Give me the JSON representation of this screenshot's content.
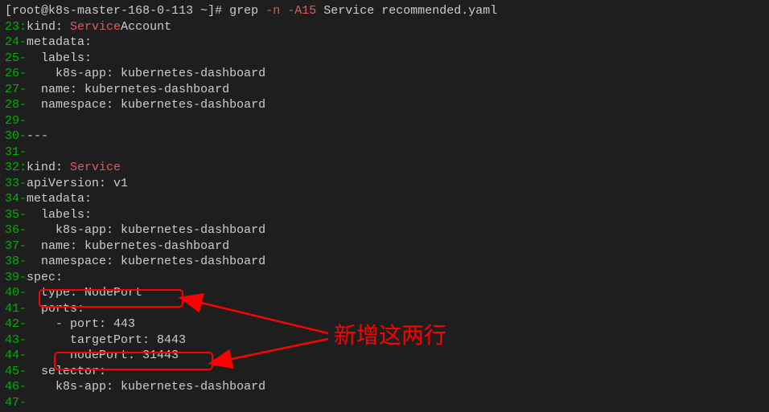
{
  "prompt": {
    "user": "root",
    "host": "k8s-master-168-0-113",
    "path": "~",
    "symbol": "#"
  },
  "command": {
    "base": "grep",
    "flags": "-n -A15",
    "pattern": "Service",
    "file": "recommended.yaml"
  },
  "lines": [
    {
      "no": "23",
      "sep": ":",
      "pre": "kind: ",
      "match": "Service",
      "post": "Account"
    },
    {
      "no": "24",
      "sep": "-",
      "pre": "metadata:",
      "match": "",
      "post": ""
    },
    {
      "no": "25",
      "sep": "-",
      "pre": "  labels:",
      "match": "",
      "post": ""
    },
    {
      "no": "26",
      "sep": "-",
      "pre": "    k8s-app: kubernetes-dashboard",
      "match": "",
      "post": ""
    },
    {
      "no": "27",
      "sep": "-",
      "pre": "  name: kubernetes-dashboard",
      "match": "",
      "post": ""
    },
    {
      "no": "28",
      "sep": "-",
      "pre": "  namespace: kubernetes-dashboard",
      "match": "",
      "post": ""
    },
    {
      "no": "29",
      "sep": "-",
      "pre": "",
      "match": "",
      "post": ""
    },
    {
      "no": "30",
      "sep": "-",
      "pre": "---",
      "match": "",
      "post": ""
    },
    {
      "no": "31",
      "sep": "-",
      "pre": "",
      "match": "",
      "post": ""
    },
    {
      "no": "32",
      "sep": ":",
      "pre": "kind: ",
      "match": "Service",
      "post": ""
    },
    {
      "no": "33",
      "sep": "-",
      "pre": "apiVersion: v1",
      "match": "",
      "post": ""
    },
    {
      "no": "34",
      "sep": "-",
      "pre": "metadata:",
      "match": "",
      "post": ""
    },
    {
      "no": "35",
      "sep": "-",
      "pre": "  labels:",
      "match": "",
      "post": ""
    },
    {
      "no": "36",
      "sep": "-",
      "pre": "    k8s-app: kubernetes-dashboard",
      "match": "",
      "post": ""
    },
    {
      "no": "37",
      "sep": "-",
      "pre": "  name: kubernetes-dashboard",
      "match": "",
      "post": ""
    },
    {
      "no": "38",
      "sep": "-",
      "pre": "  namespace: kubernetes-dashboard",
      "match": "",
      "post": ""
    },
    {
      "no": "39",
      "sep": "-",
      "pre": "spec:",
      "match": "",
      "post": ""
    },
    {
      "no": "40",
      "sep": "-",
      "pre": "  type: NodePort",
      "match": "",
      "post": ""
    },
    {
      "no": "41",
      "sep": "-",
      "pre": "  ports:",
      "match": "",
      "post": ""
    },
    {
      "no": "42",
      "sep": "-",
      "pre": "    - port: 443",
      "match": "",
      "post": ""
    },
    {
      "no": "43",
      "sep": "-",
      "pre": "      targetPort: 8443",
      "match": "",
      "post": ""
    },
    {
      "no": "44",
      "sep": "-",
      "pre": "      nodePort: 31443",
      "match": "",
      "post": ""
    },
    {
      "no": "45",
      "sep": "-",
      "pre": "  selector:",
      "match": "",
      "post": ""
    },
    {
      "no": "46",
      "sep": "-",
      "pre": "    k8s-app: kubernetes-dashboard",
      "match": "",
      "post": ""
    },
    {
      "no": "47",
      "sep": "-",
      "pre": "",
      "match": "",
      "post": ""
    }
  ],
  "annotation": {
    "label": "新增这两行"
  }
}
